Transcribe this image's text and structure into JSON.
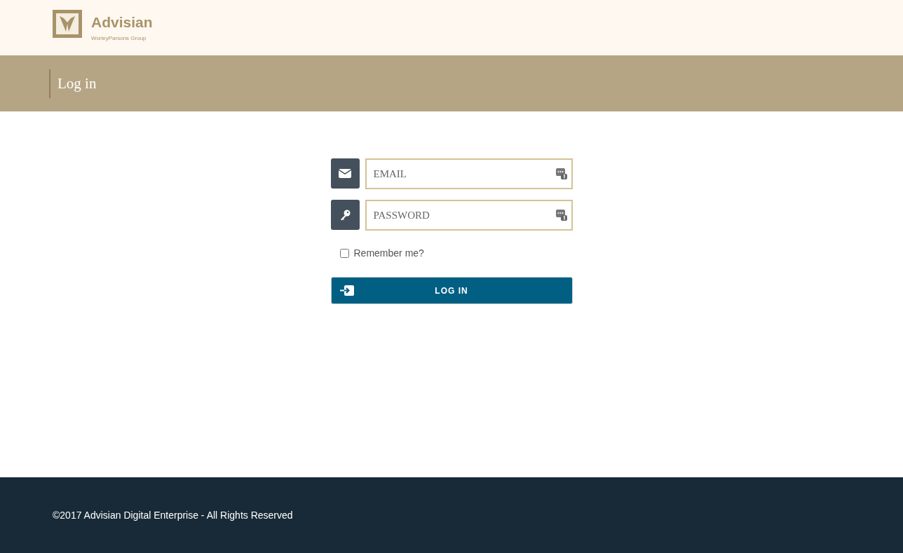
{
  "header": {
    "logo": {
      "name": "Advisian",
      "tagline": "WorleyParsons Group"
    }
  },
  "banner": {
    "title": "Log in"
  },
  "form": {
    "fields": [
      {
        "kind": "email",
        "placeholder": "EMAIL"
      },
      {
        "kind": "password",
        "placeholder": "PASSWORD"
      }
    ],
    "remember": {
      "label": "Remember me?",
      "checked": false
    },
    "submit": "LOG IN"
  },
  "footer": {
    "text": "©2017 Advisian Digital Enterprise - All Rights Reserved"
  }
}
